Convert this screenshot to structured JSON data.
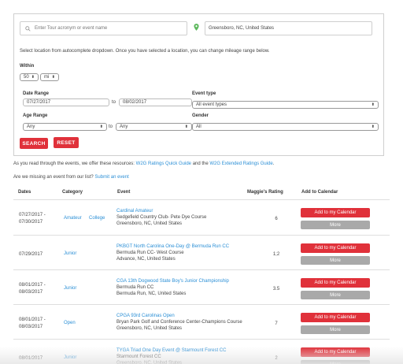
{
  "search": {
    "query_placeholder": "Enter Tour acronym or event name",
    "location_value": "Greensboro, NC, United States",
    "instructions": "Select location from autocomplete dropdown. Once you have selected a location, you can change mileage range below.",
    "within_label": "Within",
    "within_value": "50",
    "within_unit": "mi",
    "date_range_label": "Date Range",
    "date_from": "07/27/2017",
    "date_to_word": "to",
    "date_to": "08/02/2017",
    "event_type_label": "Event type",
    "event_type_value": "All event types",
    "age_range_label": "Age Range",
    "age_from": "Any",
    "age_to_word": "to",
    "age_to": "Any",
    "gender_label": "Gender",
    "gender_value": "All",
    "search_button": "SEARCH",
    "reset_button": "RESET",
    "icons": {
      "search": "search-icon",
      "location": "location-pin-icon",
      "select": "updown-arrows-icon"
    }
  },
  "resources": {
    "prefix": "As you read through the events, we offer these resources:",
    "quick_guide": "W2G Ratings Quick Guide",
    "and_word": "and the",
    "extended_guide": "W2G Extended Ratings Guide",
    "suffix": ".",
    "missing_prefix": "Are we missing an event from our list?",
    "submit_link": "Submit an event"
  },
  "table": {
    "headers": [
      "Dates",
      "Category",
      "Event",
      "Maggie's Rating",
      "Add to Calendar"
    ],
    "add_label": "Add to my Calendar",
    "more_label": "More",
    "rows": [
      {
        "date1": "07/27/2017 -",
        "date2": "07/30/2017",
        "cat1": "Amateur",
        "cat2": "College",
        "event": "Cardinal Amateur",
        "course": "Sedgefield Country Club- Pete Dye Course",
        "location": "Greensboro, NC, United States",
        "rating": "6"
      },
      {
        "date1": "07/29/2017",
        "date2": "",
        "cat1": "Junior",
        "cat2": "",
        "event": "PKBGT North Carolina One-Day @ Bermuda Run CC",
        "course": "Bermuda Run CC- West Course",
        "location": "Advance, NC, United States",
        "rating": "1;2"
      },
      {
        "date1": "08/01/2017 -",
        "date2": "08/03/2017",
        "cat1": "Junior",
        "cat2": "",
        "event": "CGA 13th Dogwood State Boy's Junior Championship",
        "course": "Bermuda Run CC",
        "location": "Bermuda Run, NC, United States",
        "rating": "3.5"
      },
      {
        "date1": "08/01/2017 -",
        "date2": "08/03/2017",
        "cat1": "Open",
        "cat2": "",
        "event": "CPGA 93rd Carolinas Open",
        "course": "Bryan Park Golf and Conference Center-Champions Course",
        "location": "Greensboro, NC, United States",
        "rating": "7"
      },
      {
        "date1": "08/01/2017",
        "date2": "",
        "cat1": "Junior",
        "cat2": "",
        "event": "TYGA Triad One Day Event @ Starmount Forest CC",
        "course": "Starmount Forest CC",
        "location": "Greensboro, NC, United States",
        "rating": "2"
      }
    ]
  },
  "colors": {
    "accent_red": "#e0313a",
    "link_blue": "#2b8fd6",
    "more_gray": "#a9a9a9",
    "pin_green": "#5cb85c"
  }
}
